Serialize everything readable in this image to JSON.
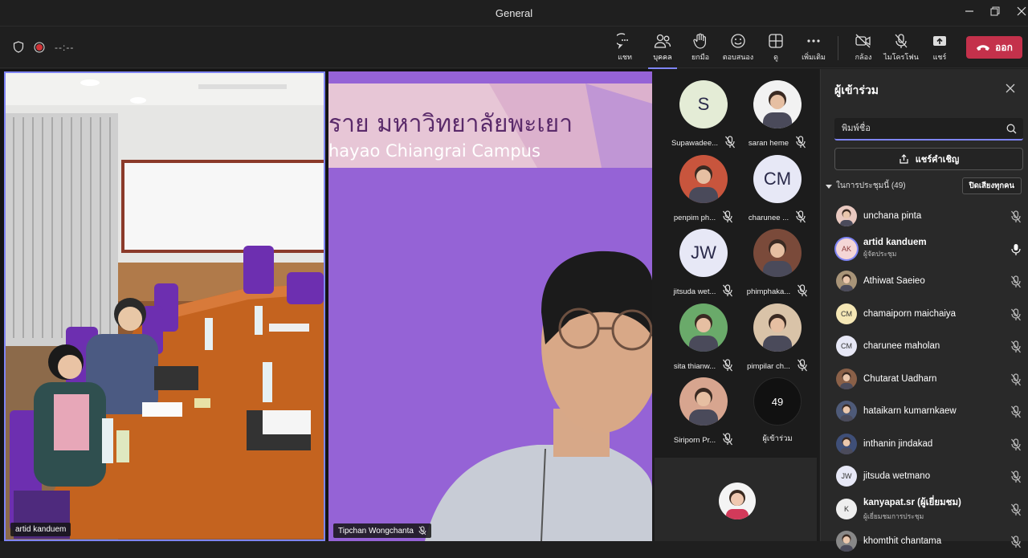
{
  "window": {
    "title": "General"
  },
  "toolbar": {
    "timer": "--:--",
    "chat": "แชท",
    "people": "บุคคล",
    "raise_hand": "ยกมือ",
    "reactions": "ตอบสนอง",
    "view": "ดู",
    "more": "เพิ่มเติม",
    "camera": "กล้อง",
    "mic": "ไมโครโฟน",
    "share": "แชร์",
    "leave": "ออก"
  },
  "videos": {
    "left_name": "artid kanduem",
    "right_name": "Tipchan Wongchanta",
    "banner_line1": "ราย มหาวิทยาลัยพะเยา",
    "banner_line2": "hayao Chiangrai Campus"
  },
  "gallery": [
    {
      "initials": "S",
      "name": "Supawadee...",
      "color": "#e4ecd6"
    },
    {
      "initials": "",
      "name": "saran heme",
      "color": "#f2f2f2"
    },
    {
      "initials": "",
      "name": "penpim ph...",
      "color": "#c8553d"
    },
    {
      "initials": "CM",
      "name": "charunee ...",
      "color": "#e7e8f6"
    },
    {
      "initials": "JW",
      "name": "jitsuda wet...",
      "color": "#e7e8f6"
    },
    {
      "initials": "",
      "name": "phimphaka...",
      "color": "#7a4a3a"
    },
    {
      "initials": "",
      "name": "sita thianw...",
      "color": "#6aaa6a"
    },
    {
      "initials": "",
      "name": "pimpilar ch...",
      "color": "#d9c3a8"
    },
    {
      "initials": "",
      "name": "Siriporn Pr...",
      "color": "#d7a58f"
    },
    {
      "initials": "49",
      "name": "ผู้เข้าร่วม",
      "color": "#111111"
    }
  ],
  "panel": {
    "title": "ผู้เข้าร่วม",
    "search_placeholder": "พิมพ์ชื่อ",
    "invite": "แชร์คำเชิญ",
    "section": "ในการประชุมนี้ (49)",
    "mute_all": "ปิดเสียงทุกคน",
    "participants": [
      {
        "initials": "",
        "name": "unchana pinta",
        "role": "",
        "color": "#e9c9c0",
        "bold": false
      },
      {
        "initials": "AK",
        "name": "artid kanduem",
        "role": "ผู้จัดประชุม",
        "color": "#f4d6d6",
        "bold": true
      },
      {
        "initials": "",
        "name": "Athiwat Saeieo",
        "role": "",
        "color": "#a89478",
        "bold": false
      },
      {
        "initials": "CM",
        "name": "chamaiporn maichaiya",
        "role": "",
        "color": "#f5e7b5",
        "bold": false
      },
      {
        "initials": "CM",
        "name": "charunee maholan",
        "role": "",
        "color": "#e7e8f6",
        "bold": false
      },
      {
        "initials": "",
        "name": "Chutarat Uadharn",
        "role": "",
        "color": "#8a6048",
        "bold": false
      },
      {
        "initials": "",
        "name": "hataikarn kumarnkaew",
        "role": "",
        "color": "#4e5a78",
        "bold": false
      },
      {
        "initials": "",
        "name": "inthanin jindakad",
        "role": "",
        "color": "#3f4f78",
        "bold": false
      },
      {
        "initials": "JW",
        "name": "jitsuda wetmano",
        "role": "",
        "color": "#e7e8f6",
        "bold": false
      },
      {
        "initials": "K",
        "name": "kanyapat.sr (ผู้เยี่ยมชม)",
        "role": "ผู้เยี่ยมชมการประชุม",
        "color": "#eeeeee",
        "bold": true
      },
      {
        "initials": "",
        "name": "khomthit chantama",
        "role": "",
        "color": "#888888",
        "bold": false
      }
    ]
  }
}
